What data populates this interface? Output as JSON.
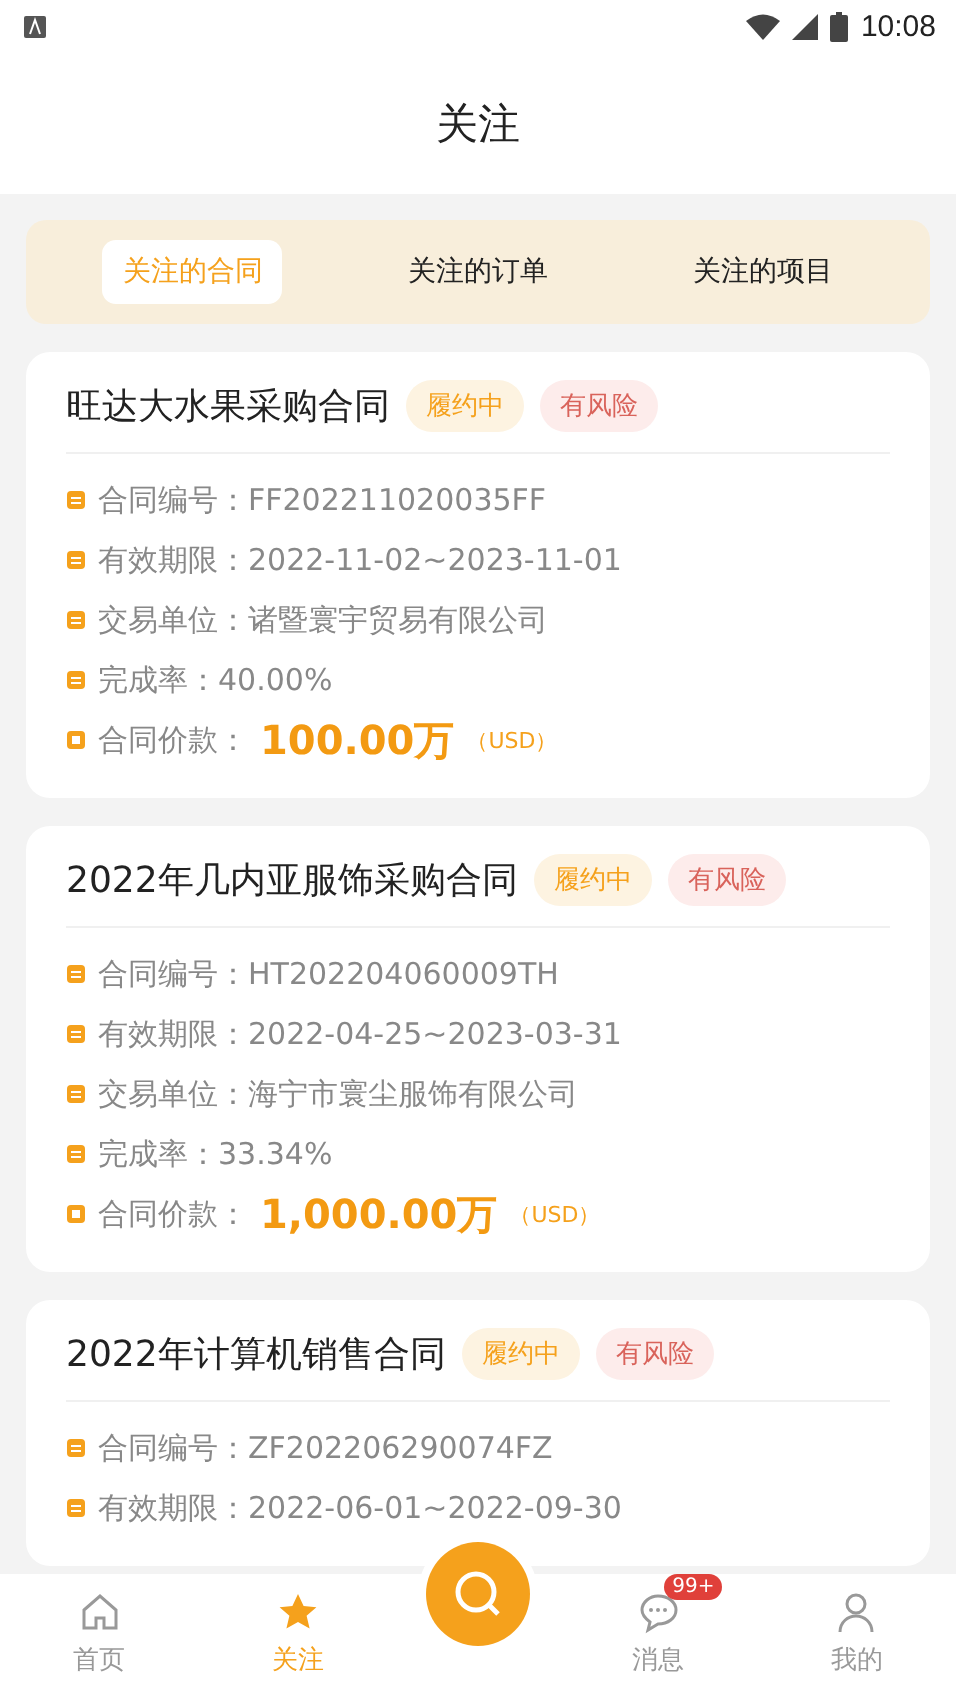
{
  "status_bar": {
    "time": "10:08"
  },
  "header": {
    "title": "关注"
  },
  "tabs": [
    {
      "label": "关注的合同",
      "selected": true
    },
    {
      "label": "关注的订单",
      "selected": false
    },
    {
      "label": "关注的项目",
      "selected": false
    }
  ],
  "contracts": [
    {
      "title": "旺达大水果采购合同",
      "tags": [
        {
          "label": "履约中",
          "kind": "status"
        },
        {
          "label": "有风险",
          "kind": "risk"
        }
      ],
      "rows": [
        {
          "kind": "number",
          "label": "合同编号：",
          "value": "FF202211020035FF"
        },
        {
          "kind": "period",
          "label": "有效期限：",
          "value": "2022-11-02~2023-11-01"
        },
        {
          "kind": "party",
          "label": "交易单位：",
          "value": "诸暨寰宇贸易有限公司"
        },
        {
          "kind": "rate",
          "label": "完成率：",
          "value": "40.00%"
        },
        {
          "kind": "price",
          "label": "合同价款：",
          "value": "100.00万",
          "unit": "（USD）"
        }
      ]
    },
    {
      "title": "2022年几内亚服饰采购合同",
      "tags": [
        {
          "label": "履约中",
          "kind": "status"
        },
        {
          "label": "有风险",
          "kind": "risk"
        }
      ],
      "rows": [
        {
          "kind": "number",
          "label": "合同编号：",
          "value": "HT202204060009TH"
        },
        {
          "kind": "period",
          "label": "有效期限：",
          "value": "2022-04-25~2023-03-31"
        },
        {
          "kind": "party",
          "label": "交易单位：",
          "value": "海宁市寰尘服饰有限公司"
        },
        {
          "kind": "rate",
          "label": "完成率：",
          "value": "33.34%"
        },
        {
          "kind": "price",
          "label": "合同价款：",
          "value": "1,000.00万",
          "unit": "（USD）"
        }
      ]
    },
    {
      "title": "2022年计算机销售合同",
      "tags": [
        {
          "label": "履约中",
          "kind": "status"
        },
        {
          "label": "有风险",
          "kind": "risk"
        }
      ],
      "rows": [
        {
          "kind": "number",
          "label": "合同编号：",
          "value": "ZF202206290074FZ"
        },
        {
          "kind": "period",
          "label": "有效期限：",
          "value": "2022-06-01~2022-09-30"
        }
      ]
    }
  ],
  "nav": [
    {
      "kind": "home",
      "label": "首页",
      "selected": false
    },
    {
      "kind": "star",
      "label": "关注",
      "selected": true
    },
    {
      "kind": "search"
    },
    {
      "kind": "message",
      "label": "消息",
      "selected": false,
      "badge": "99+"
    },
    {
      "kind": "user",
      "label": "我的",
      "selected": false
    }
  ]
}
